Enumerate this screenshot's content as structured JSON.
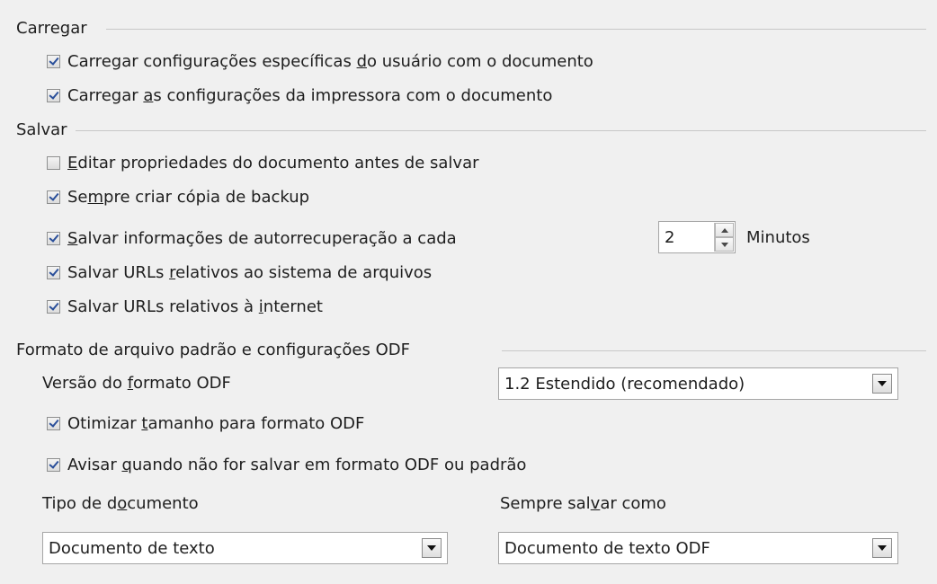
{
  "load": {
    "title": "Carregar",
    "user_settings": {
      "pre": "Carregar configurações específicas ",
      "key": "d",
      "post": "o usuário com o documento",
      "checked": true
    },
    "printer_settings": {
      "pre": "Carregar ",
      "key": "a",
      "post": "s configurações da impressora com o documento",
      "checked": true
    }
  },
  "save": {
    "title": "Salvar",
    "edit_props": {
      "pre": "",
      "key": "E",
      "post": "ditar propriedades do documento antes de salvar",
      "checked": false
    },
    "backup": {
      "pre": "Se",
      "key": "m",
      "post": "pre criar cópia de backup",
      "checked": true
    },
    "autorecovery": {
      "pre": "",
      "key": "S",
      "post": "alvar informações de autorrecuperação a cada",
      "checked": true,
      "minutes_value": "2",
      "minutes_label": "Minutos"
    },
    "relative_fs": {
      "pre": "Salvar URLs ",
      "key": "r",
      "post": "elativos ao sistema de arquivos",
      "checked": true
    },
    "relative_web": {
      "pre": "Salvar URLs relativos à ",
      "key": "i",
      "post": "nternet",
      "checked": true
    }
  },
  "format": {
    "title": "Formato de arquivo padrão e configurações ODF",
    "odf_version_label": {
      "pre": "Versão do ",
      "key": "f",
      "post": "ormato ODF"
    },
    "odf_version_value": "1.2 Estendido (recomendado)",
    "optimize": {
      "pre": "Otimizar ",
      "key": "t",
      "post": "amanho para formato ODF",
      "checked": true
    },
    "warn": {
      "pre": "Avisar ",
      "key": "q",
      "post": "uando não for salvar em formato ODF ou padrão",
      "checked": true
    },
    "doc_type_label": {
      "pre": "Tipo de d",
      "key": "o",
      "post": "cumento"
    },
    "doc_type_value": "Documento de texto",
    "always_save_label": {
      "pre": "Sempre sal",
      "key": "v",
      "post": "ar como"
    },
    "always_save_value": "Documento de texto ODF"
  }
}
